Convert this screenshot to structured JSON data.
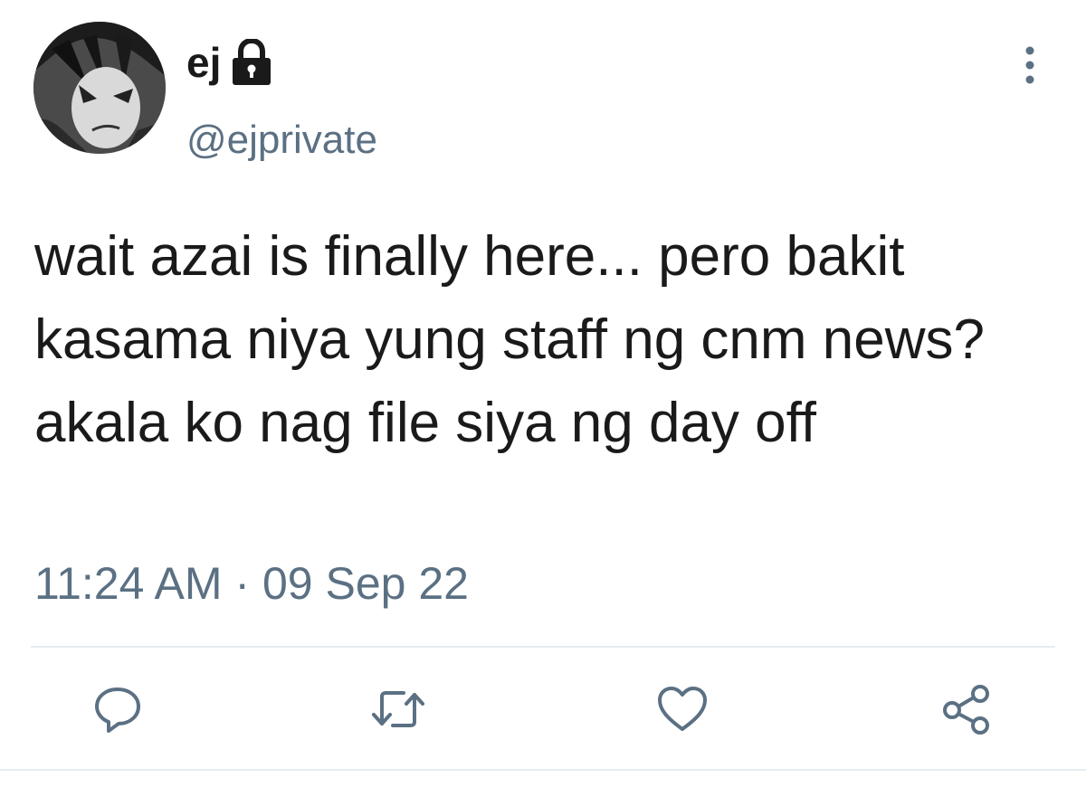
{
  "author": {
    "display_name": "ej",
    "handle": "@ejprivate",
    "avatar_icon": "anime-avatar",
    "protected_icon": "lock-icon"
  },
  "tweet": {
    "text": "wait azai is finally here... pero bakit kasama niya yung staff ng cnm news? akala ko nag file siya ng day off",
    "timestamp": "11:24 AM · 09 Sep 22"
  },
  "actions": [
    {
      "name": "reply",
      "icon": "reply-icon"
    },
    {
      "name": "retweet",
      "icon": "retweet-icon"
    },
    {
      "name": "like",
      "icon": "heart-icon"
    },
    {
      "name": "share",
      "icon": "share-icon"
    }
  ],
  "colors": {
    "text": "#1a1a1a",
    "secondary": "#5b7083",
    "divider": "#e6ecf0"
  }
}
